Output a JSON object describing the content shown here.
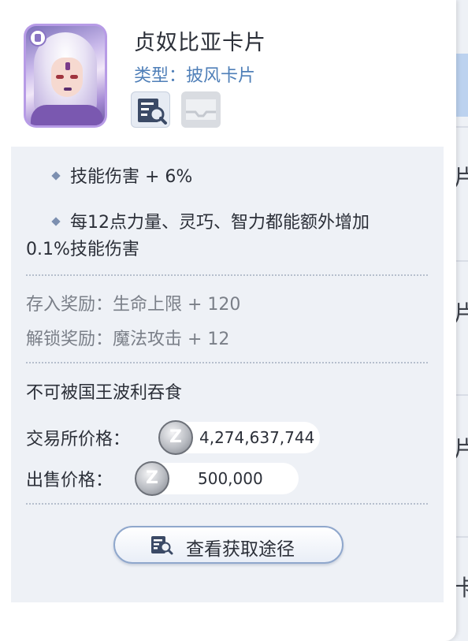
{
  "card": {
    "name": "贞奴比亚卡片",
    "type_line": "类型：披风卡片"
  },
  "effects": [
    "技能伤害 + 6%",
    "每12点力量、灵巧、智力都能额外增加",
    "0.1%技能伤害"
  ],
  "rewards": {
    "deposit": "存入奖励：生命上限 + 120",
    "unlock": "解锁奖励：魔法攻击 + 12"
  },
  "note": "不可被国王波利吞食",
  "prices": {
    "exchange_label": "交易所价格：",
    "exchange_value": "4,274,637,744",
    "sell_label": "出售价格：",
    "sell_value": "500,000",
    "currency_symbol": "Z"
  },
  "actions": {
    "view_source_label": "查看获取途径"
  },
  "background_chars": [
    "片",
    "片",
    "片",
    "卡"
  ],
  "colors": {
    "accent_blue": "#4f7fb8",
    "card_frame": "#b79be6"
  }
}
